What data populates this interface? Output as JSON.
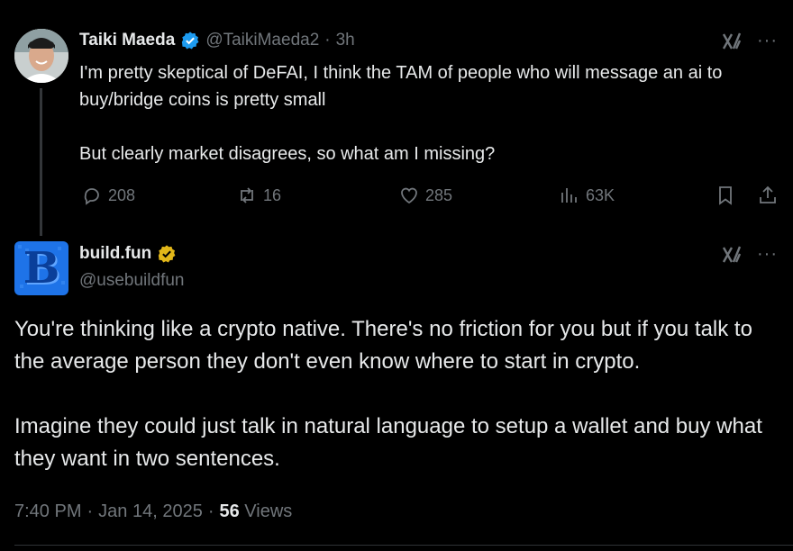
{
  "parent_tweet": {
    "author_name": "Taiki Maeda",
    "handle": "@TaikiMaeda2",
    "separator": "·",
    "time": "3h",
    "text": "I'm pretty skeptical of DeFAI, I think the TAM of people who will message an ai to buy/bridge coins is pretty small\n\nBut clearly market disagrees, so what am I missing?",
    "replies": "208",
    "reposts": "16",
    "likes": "285",
    "views": "63K"
  },
  "reply_tweet": {
    "author_name": "build.fun",
    "handle": "@usebuildfun",
    "avatar_letter": "B",
    "text": "You're thinking like a crypto native. There's no friction for you but if you talk to the average person they don't even know where to start in crypto.\n\nImagine they could just talk in natural language to setup a wallet and buy what they want in two sentences.",
    "time": "7:40 PM",
    "sep1": "·",
    "date": "Jan 14, 2025",
    "sep2": "·",
    "views_count": "56",
    "views_label": "Views"
  },
  "icons": {
    "more": "···"
  },
  "colors": {
    "verified_blue": "#1d9bf0",
    "verified_gold": "#e2b719",
    "avatar_blue": "#1e73e8"
  }
}
